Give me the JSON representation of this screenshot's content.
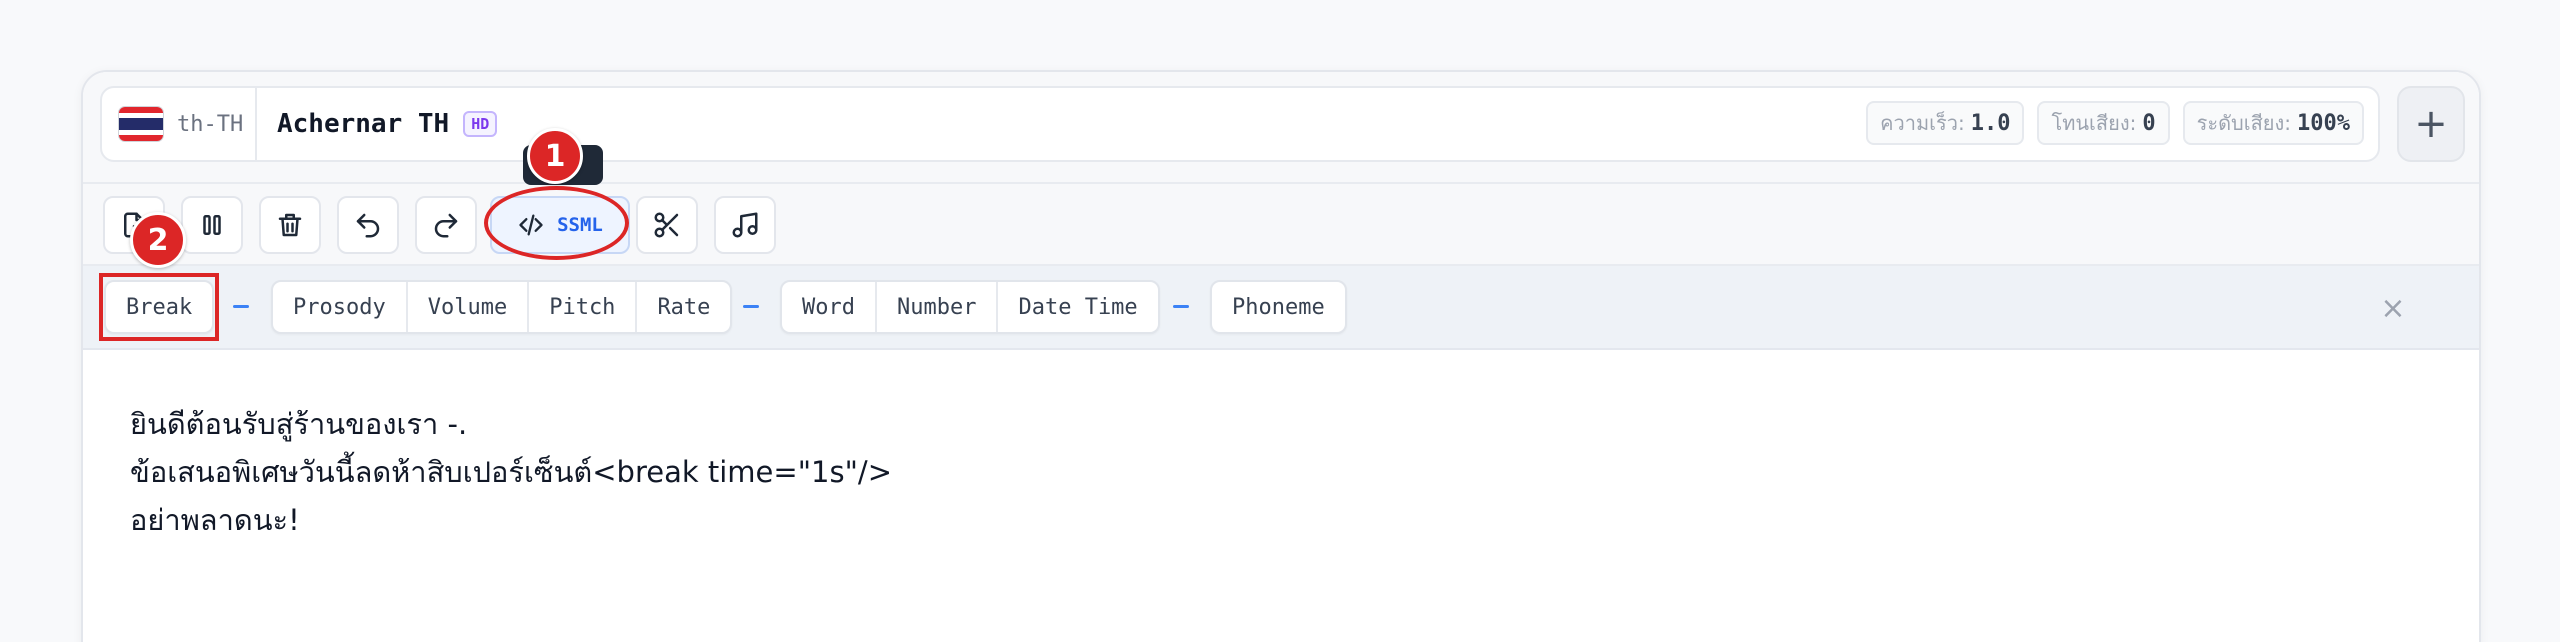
{
  "header": {
    "lang_code": "th-TH",
    "voice_name": "Achernar TH",
    "hd_badge": "HD",
    "params": [
      {
        "label": "ความเร็ว:",
        "value": "1.0"
      },
      {
        "label": "โทนเสียง:",
        "value": "0"
      },
      {
        "label": "ระดับเสียง:",
        "value": "100%"
      }
    ],
    "add_label": "+"
  },
  "toolbar": {
    "ssml_label": "SSML",
    "icons": [
      "file-export-icon",
      "pause-icon",
      "trash-icon",
      "undo-icon",
      "redo-icon",
      "code-icon",
      "scissors-icon",
      "music-icon"
    ]
  },
  "tagbar": {
    "groups": [
      [
        "Break"
      ],
      [
        "Prosody",
        "Volume",
        "Pitch",
        "Rate"
      ],
      [
        "Word",
        "Number",
        "Date Time"
      ],
      [
        "Phoneme"
      ]
    ],
    "close_label": "×"
  },
  "editor": {
    "lines": [
      "ยินดีต้อนรับสู่ร้านของเรา -.",
      "ข้อเสนอพิเศษวันนี้ลดห้าสิบเปอร์เซ็นต์<break time=\"1s\"/>",
      "อย่าพลาดนะ!"
    ]
  },
  "annotations": {
    "badge_1": "1",
    "badge_2": "2",
    "accent_color": "#dc2626"
  }
}
